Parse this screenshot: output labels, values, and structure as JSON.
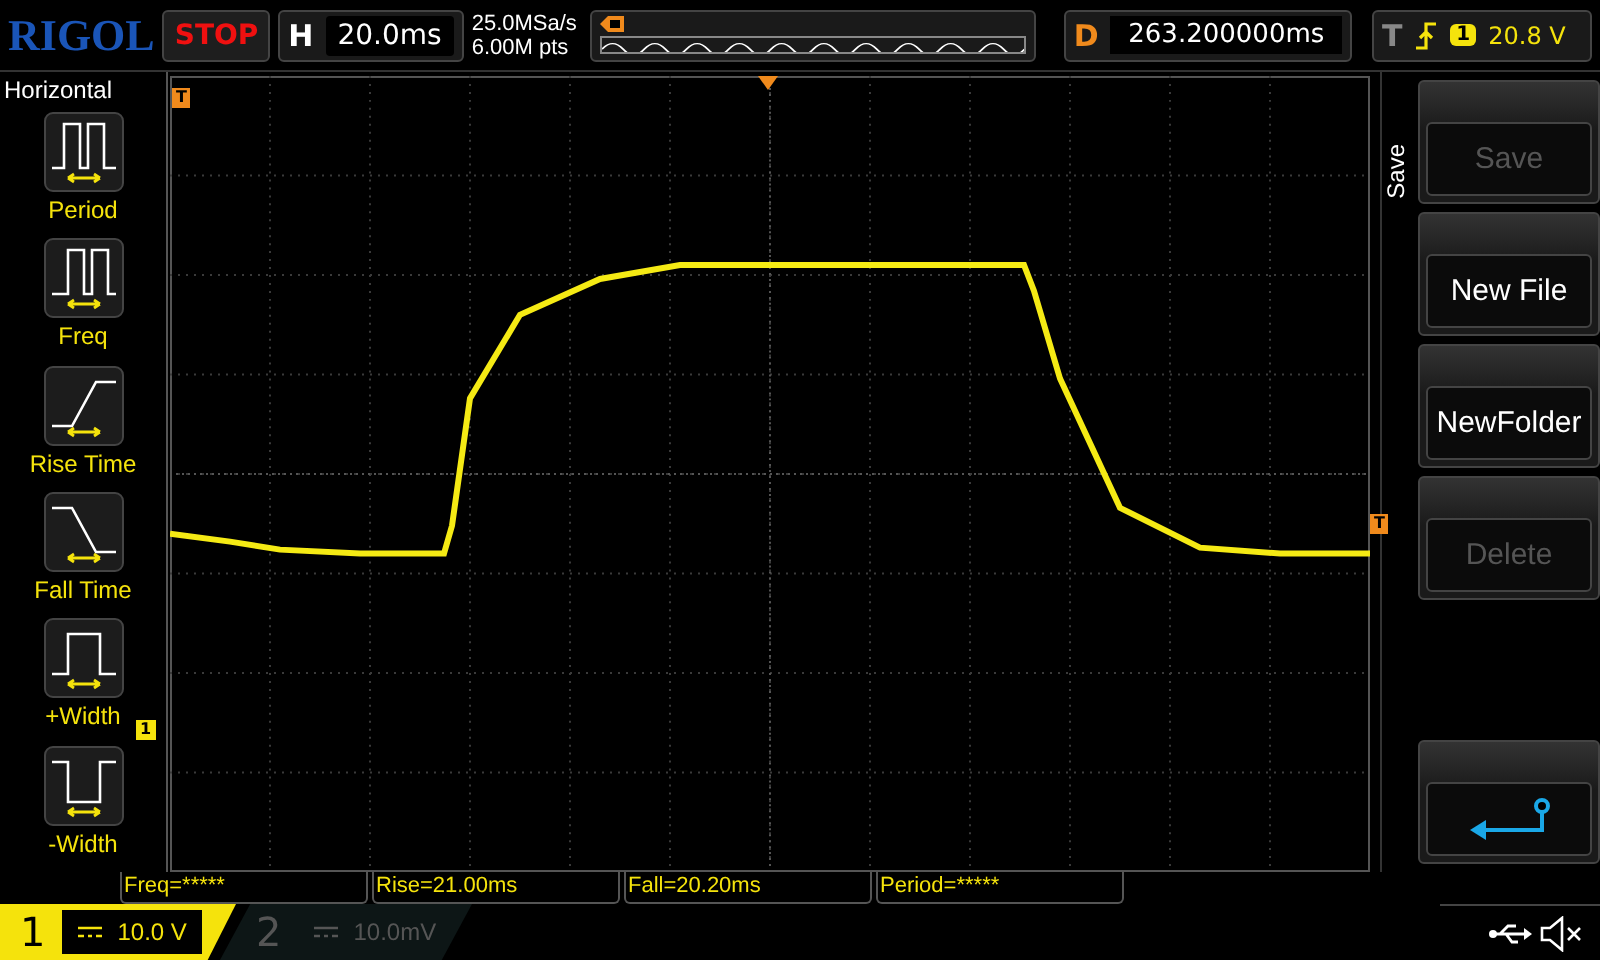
{
  "logo": "RIGOL",
  "run_state": "STOP",
  "horizontal": {
    "label": "H",
    "timebase": "20.0ms"
  },
  "sample_rate": "25.0MSa/s",
  "memory_depth": "6.00M pts",
  "delay": {
    "label": "D",
    "value": "263.200000ms"
  },
  "trigger": {
    "label": "T",
    "source": "1",
    "level": "20.8 V"
  },
  "left_menu": {
    "title": "Horizontal",
    "items": [
      {
        "label": "Period",
        "kind": "period"
      },
      {
        "label": "Freq",
        "kind": "freq"
      },
      {
        "label": "Rise Time",
        "kind": "rise"
      },
      {
        "label": "Fall Time",
        "kind": "fall"
      },
      {
        "label": "+Width",
        "kind": "pwidth"
      },
      {
        "label": "-Width",
        "kind": "nwidth"
      }
    ]
  },
  "markers": {
    "trigger_position": "T",
    "trigger_level": "T",
    "channel": "1"
  },
  "right_menu": {
    "title": "Save",
    "buttons": [
      {
        "kind": "text",
        "label": "Save",
        "disabled": true
      },
      {
        "kind": "text",
        "label": "New File",
        "disabled": false
      },
      {
        "kind": "text",
        "label": "NewFolder",
        "disabled": false
      },
      {
        "kind": "text",
        "label": "Delete",
        "disabled": true
      },
      {
        "kind": "return"
      }
    ]
  },
  "measurements": [
    "Freq=*****",
    "Rise=21.00ms",
    "Fall=20.20ms",
    "Period=*****"
  ],
  "channels": [
    {
      "number": "1",
      "scale": "10.0 V",
      "selected": true
    },
    {
      "number": "2",
      "scale": "10.0mV",
      "selected": false
    }
  ]
}
